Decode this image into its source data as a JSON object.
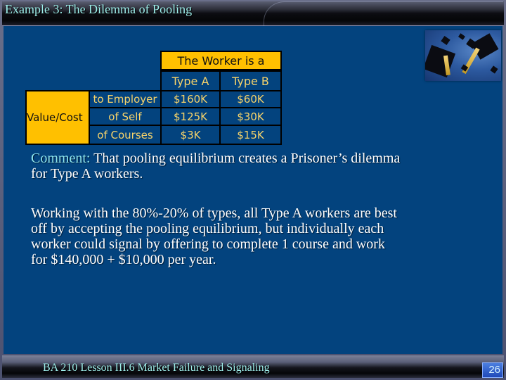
{
  "title": "Example 3: The Dilemma of Pooling",
  "photo": {
    "icon": "graduation-caps-photo",
    "description": "Graduation caps tossed in the air"
  },
  "table": {
    "header_group": "The Worker is a",
    "columns": [
      "Type A",
      "Type B"
    ],
    "row_group": "Value/Cost",
    "rows": [
      {
        "label": "to Employer",
        "values": [
          "$160K",
          "$60K"
        ]
      },
      {
        "label": "of Self",
        "values": [
          "$125K",
          "$30K"
        ]
      },
      {
        "label": "of Courses",
        "values": [
          "$3K",
          "$15K"
        ]
      }
    ],
    "colors": {
      "highlight": "#ffc000",
      "cell_background": "#03437e",
      "cell_text": "#f7d36a"
    }
  },
  "comment": {
    "label": "Comment:",
    "lines": [
      " That pooling equilibrium creates a Prisoner’s dilemma",
      "for Type A workers."
    ]
  },
  "paragraph": {
    "lines": [
      "Working with the 80%-20% of types, all Type A workers are best",
      "off by accepting the pooling equilibrium, but individually each",
      "worker could signal by offering to complete 1 course and work",
      "for $140,000 + $10,000 per year."
    ]
  },
  "footer": {
    "text": "BA 210  Lesson III.6 Market Failure and Signaling",
    "page_number": "26"
  },
  "colors": {
    "background": "#03437e",
    "title_text": "#9ff0ec",
    "body_text": "#ffffff",
    "comment_label": "#8fe6ef"
  }
}
